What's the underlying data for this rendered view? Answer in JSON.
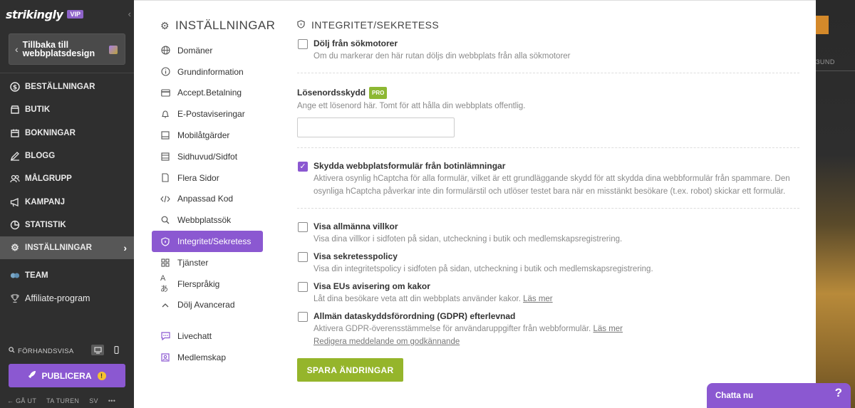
{
  "sidebar": {
    "logo": "strikingly",
    "vip_badge": "VIP",
    "back_label": "Tillbaka till webbplatsdesign",
    "nav": [
      {
        "label": "BESTÄLLNINGAR",
        "icon": "dollar-icon"
      },
      {
        "label": "BUTIK",
        "icon": "shop-icon"
      },
      {
        "label": "BOKNINGAR",
        "icon": "calendar-icon"
      },
      {
        "label": "BLOGG",
        "icon": "pen-icon"
      },
      {
        "label": "MÅLGRUPP",
        "icon": "users-icon"
      },
      {
        "label": "KAMPANJ",
        "icon": "megaphone-icon"
      },
      {
        "label": "STATISTIK",
        "icon": "chart-icon"
      },
      {
        "label": "INSTÄLLNINGAR",
        "icon": "gear-icon"
      },
      {
        "label": "TEAM",
        "icon": "team-icon"
      },
      {
        "label": "Affiliate-program",
        "icon": "trophy-icon"
      }
    ],
    "preview_label": "FÖRHANDSVISA",
    "publish_label": "PUBLICERA",
    "footer": [
      "GÅ UT",
      "TA TUREN",
      "SV",
      "•••"
    ]
  },
  "settings": {
    "title": "INSTÄLLNINGAR",
    "items": [
      {
        "label": "Domäner",
        "icon": "globe-icon"
      },
      {
        "label": "Grundinformation",
        "icon": "info-icon"
      },
      {
        "label": "Accept.Betalning",
        "icon": "card-icon"
      },
      {
        "label": "E-Postaviseringar",
        "icon": "bell-icon"
      },
      {
        "label": "Mobilåtgärder",
        "icon": "mobile-icon"
      },
      {
        "label": "Sidhuvud/Sidfot",
        "icon": "layout-icon"
      },
      {
        "label": "Flera Sidor",
        "icon": "pages-icon"
      },
      {
        "label": "Anpassad Kod",
        "icon": "code-icon"
      },
      {
        "label": "Webbplatssök",
        "icon": "search-icon"
      },
      {
        "label": "Integritet/Sekretess",
        "icon": "shield-icon"
      },
      {
        "label": "Tjänster",
        "icon": "grid-icon"
      },
      {
        "label": "Flerspråkig",
        "icon": "language-icon"
      },
      {
        "label": "Dölj Avancerad",
        "icon": "chevron-up-icon"
      },
      {
        "label": "Livechatt",
        "icon": "chat-icon"
      },
      {
        "label": "Medlemskap",
        "icon": "member-icon"
      }
    ]
  },
  "privacy": {
    "title": "INTEGRITET/SEKRETESS",
    "hide_search": {
      "label": "Dölj från sökmotorer",
      "desc": "Om du markerar den här rutan döljs din webbplats från alla sökmotorer"
    },
    "password": {
      "label": "Lösenordsskydd",
      "badge": "PRO",
      "desc": "Ange ett lösenord här. Tomt för att hålla din webbplats offentlig.",
      "value": ""
    },
    "bot": {
      "label": "Skydda webbplatsformulär från botinlämningar",
      "desc": "Aktivera osynlig hCaptcha för alla formulär, vilket är ett grundläggande skydd för att skydda dina webbformulär från spammare. Den osynliga hCaptcha påverkar inte din formulärstil och utlöser testet bara när en misstänkt besökare (t.ex. robot) skickar ett formulär."
    },
    "terms": {
      "label": "Visa allmänna villkor",
      "desc": "Visa dina villkor i sidfoten på sidan, utcheckning i butik och medlemskapsregistrering."
    },
    "policy": {
      "label": "Visa sekretesspolicy",
      "desc": "Visa din integritetspolicy i sidfoten på sidan, utcheckning i butik och medlemskapsregistrering."
    },
    "cookies": {
      "label": "Visa EUs avisering om kakor",
      "desc": "Låt dina besökare veta att din webbplats använder kakor.",
      "link": "Läs mer"
    },
    "gdpr": {
      "label": "Allmän dataskyddsförordning (GDPR) efterlevnad",
      "desc": "Aktivera GDPR-överensstämmelse för användaruppgifter från webbformulär.",
      "link": "Läs mer",
      "link2": "Redigera meddelande om godkännande"
    },
    "save_label": "SPARA ÄNDRINGAR"
  },
  "right": {
    "sound": "ЗUND"
  },
  "chat": {
    "label": "Chatta nu",
    "help": "?"
  },
  "colors": {
    "accent": "#8b58d1",
    "save": "#95b52b",
    "pro": "#8db833"
  }
}
